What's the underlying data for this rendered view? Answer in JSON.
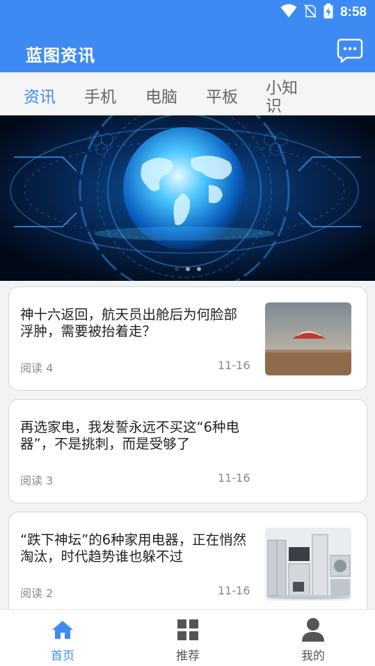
{
  "status_bar": {
    "time": "8:58"
  },
  "header": {
    "title": "蓝图资讯"
  },
  "tabs": [
    {
      "label": "资讯"
    },
    {
      "label": "手机"
    },
    {
      "label": "电脑"
    },
    {
      "label": "平板"
    },
    {
      "label": "小知识"
    }
  ],
  "banner": {
    "slides": 3,
    "active_slide": 1
  },
  "articles": [
    {
      "title": "神十六返回，航天员出舱后为何脸部浮肿，需要被抬着走？",
      "reads": "阅读 4",
      "date": "11-16",
      "thumb": "capsule-landing-image"
    },
    {
      "title": "再选家电，我发誓永远不买这“6种电器”，不是挑刺，而是受够了",
      "reads": "阅读 3",
      "date": "11-16"
    },
    {
      "title": "“跌下神坛”的6种家用电器，正在悄然淘汰，时代趋势谁也躲不过",
      "reads": "阅读 2",
      "date": "11-16",
      "thumb": "home-appliances-image"
    }
  ],
  "bottom_nav": [
    {
      "label": "首页",
      "icon": "home-icon"
    },
    {
      "label": "推荐",
      "icon": "grid-icon"
    },
    {
      "label": "我的",
      "icon": "user-icon"
    }
  ],
  "colors": {
    "primary": "#3d8bf2",
    "text": "#222222",
    "muted": "#888888"
  }
}
